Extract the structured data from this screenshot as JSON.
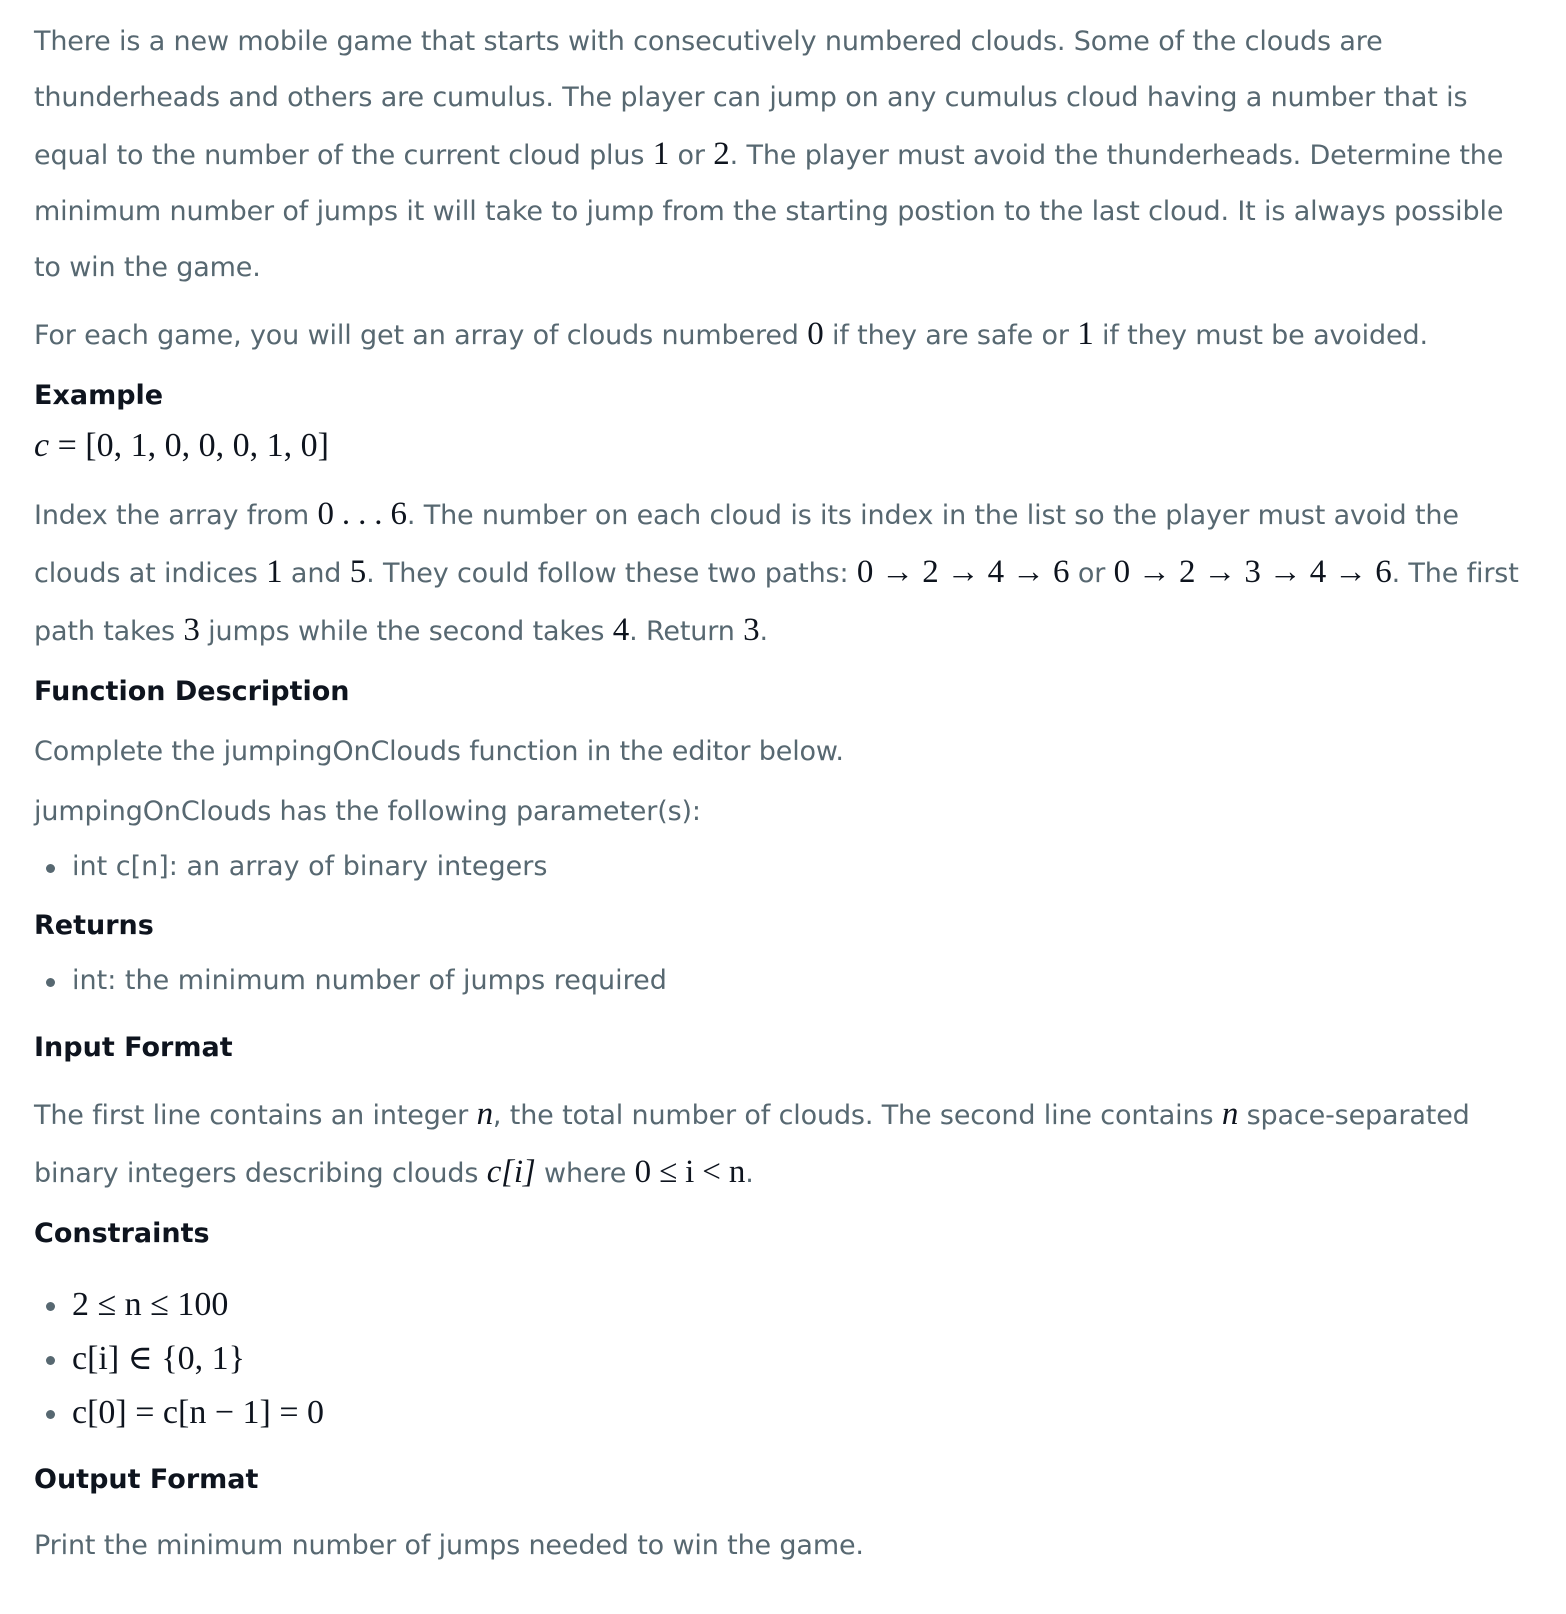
{
  "intro": {
    "p1_a": "There is a new mobile game that starts with consecutively numbered clouds. Some of the clouds are thunderheads and others are cumulus. The player can jump on any cumulus cloud having a number that is equal to the number of the current cloud plus ",
    "p1_m1": "1",
    "p1_b": " or ",
    "p1_m2": "2",
    "p1_c": ". The player must avoid the thunderheads. Determine the minimum number of jumps it will take to jump from the starting postion to the last cloud. It is always possible to win the game.",
    "p2_a": "For each game, you will get an array of clouds numbered ",
    "p2_m1": "0",
    "p2_b": " if they are safe or ",
    "p2_m2": "1",
    "p2_c": " if they must be avoided."
  },
  "example": {
    "heading": "Example",
    "formula_var": "c",
    "formula_rest": " = [0, 1, 0, 0, 0, 1, 0]",
    "t1": "Index the array from ",
    "m_range": "0 . . . 6",
    "t2": ". The number on each cloud is its index in the list so the player must avoid the clouds at indices ",
    "m_i1": "1",
    "t3": " and ",
    "m_i2": "5",
    "t4": ". They could follow these two paths: ",
    "m_path1": "0 → 2 → 4 → 6",
    "t5": " or ",
    "m_path2": "0 → 2 → 3 → 4 → 6",
    "t6": ". The first path takes ",
    "m_j1": "3",
    "t7": " jumps while the second takes ",
    "m_j2": "4",
    "t8": ". Return ",
    "m_ret": "3",
    "t9": "."
  },
  "function_description": {
    "heading": "Function Description",
    "line1": "Complete the jumpingOnClouds function in the editor below.",
    "line2": "jumpingOnClouds has the following parameter(s):",
    "params": [
      "int c[n]: an array of binary integers"
    ]
  },
  "returns": {
    "heading": "Returns",
    "items": [
      "int: the minimum number of jumps required"
    ]
  },
  "input_format": {
    "heading": "Input Format",
    "t1": "The first line contains an integer ",
    "m_n1": "n",
    "t2": ", the total number of clouds. The second line contains ",
    "m_n2": "n",
    "t3": " space-separated binary integers describing clouds ",
    "m_ci": "c[i]",
    "t4": " where ",
    "m_range": "0 ≤ i < n",
    "t5": "."
  },
  "constraints": {
    "heading": "Constraints",
    "items": [
      "2 ≤ n ≤ 100",
      "c[i] ∈ {0, 1}",
      "c[0] = c[n − 1] = 0"
    ]
  },
  "output_format": {
    "heading": "Output Format",
    "text": "Print the minimum number of jumps needed to win the game."
  }
}
